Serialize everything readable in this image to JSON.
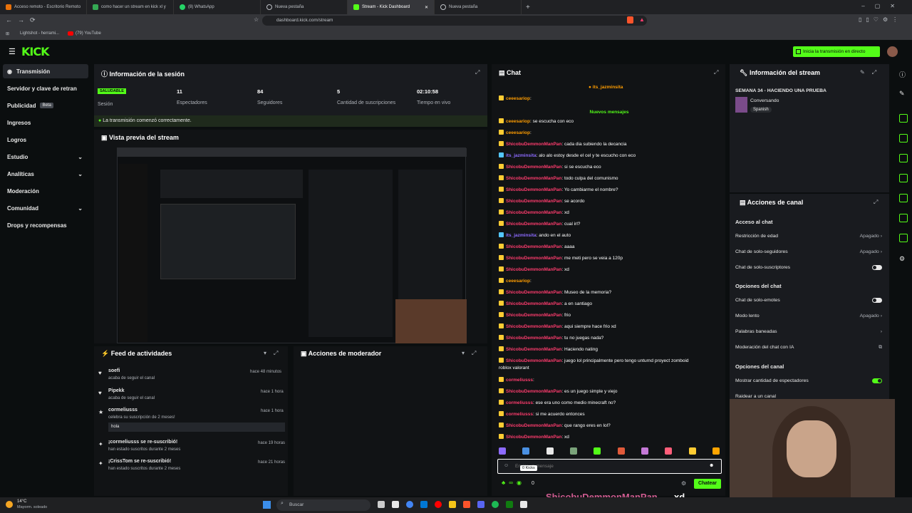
{
  "browser": {
    "tabs": [
      {
        "label": "Acceso remoto - Escritorio Remoto",
        "active": false
      },
      {
        "label": "como hacer un stream en kick xl y",
        "active": false
      },
      {
        "label": "(8) WhatsApp",
        "active": false
      },
      {
        "label": "Nueva pestaña",
        "active": false
      },
      {
        "label": "Stream - Kick Dashboard",
        "active": true
      },
      {
        "label": "Nueva pestaña",
        "active": false
      }
    ],
    "url": "dashboard.kick.com/stream",
    "bookmarks": [
      "Lightshot - herrami...",
      "(79) YouTube"
    ]
  },
  "header": {
    "logo": "KICK",
    "go_live": "Inicia la transmisión en directo"
  },
  "sidebar": {
    "items": [
      "Transmisión",
      "Servidor y clave de retran",
      "Publicidad",
      "Ingresos",
      "Logros",
      "Estudio",
      "Analíticas",
      "Moderación",
      "Comunidad",
      "Drops y recompensas"
    ],
    "beta": "Beta"
  },
  "session": {
    "title": "Información de la sesión",
    "status": "SALUDABLE",
    "status_label": "Sesión",
    "stats": [
      {
        "value": "11",
        "label": "Espectadores"
      },
      {
        "value": "84",
        "label": "Seguidores"
      },
      {
        "value": "5",
        "label": "Cantidad de suscripciones"
      },
      {
        "value": "02:10:58",
        "label": "Tiempo en vivo"
      }
    ],
    "message": "La transmisión comenzó correctamente."
  },
  "preview": {
    "title": "Vista previa del stream"
  },
  "feed": {
    "title": "Feed de actividades",
    "items": [
      {
        "user": "soefi",
        "desc": "acaba de seguir el canal",
        "time": "hace 48 minutos"
      },
      {
        "user": "Pipekk",
        "desc": "acaba de seguir el canal",
        "time": "hace 1 hora"
      },
      {
        "user": "cormeliusss",
        "desc": "celebra su suscripción de 2 meses!",
        "time": "hace 1 hora",
        "msg": "hola"
      },
      {
        "user": "¡cormeliusss se re-suscribió!",
        "desc": "han estado suscritos durante 2 meses",
        "time": "hace 19 horas"
      },
      {
        "user": "¡CrissTom se re-suscribió!",
        "desc": "han estado suscritos durante 2 meses",
        "time": "hace 21 horas"
      }
    ]
  },
  "mod": {
    "title": "Acciones de moderador"
  },
  "chat": {
    "title": "Chat",
    "pinned": "its_jazminsita",
    "new_messages": "Nuevos mensajes",
    "messages": [
      {
        "user": "ceeesariop",
        "text": "",
        "style": "u2"
      },
      {
        "user": "ceeesariop",
        "text": "se escucha con eco",
        "style": "u2"
      },
      {
        "user": "ceeesariop",
        "text": "",
        "style": "u2"
      },
      {
        "user": "ShicobuDemmonManPan",
        "text": "cada dia subiendo la decancia",
        "style": "u3"
      },
      {
        "user": "its_jazminsita",
        "text": "alo alo estoy desde el cel y te escucho con eco",
        "style": "u4"
      },
      {
        "user": "ShicobuDemmonManPan",
        "text": "si se escucha eco",
        "style": "u3"
      },
      {
        "user": "ShicobuDemmonManPan",
        "text": "todo culpa del comunismo",
        "style": "u3"
      },
      {
        "user": "ShicobuDemmonManPan",
        "text": "Yo cambiarme el nombre?",
        "style": "u3"
      },
      {
        "user": "ShicobuDemmonManPan",
        "text": "se acordo",
        "style": "u3"
      },
      {
        "user": "ShicobuDemmonManPan",
        "text": "xd",
        "style": "u3"
      },
      {
        "user": "ShicobuDemmonManPan",
        "text": "cual irl?",
        "style": "u3"
      },
      {
        "user": "its_jazminsita",
        "text": "ando en el auto",
        "style": "u4"
      },
      {
        "user": "ShicobuDemmonManPan",
        "text": "aaaa",
        "style": "u3"
      },
      {
        "user": "ShicobuDemmonManPan",
        "text": "me meti pero se veia a 120p",
        "style": "u3"
      },
      {
        "user": "ShicobuDemmonManPan",
        "text": "xd",
        "style": "u3"
      },
      {
        "user": "ceeesariop",
        "text": "",
        "style": "u2"
      },
      {
        "user": "ShicobuDemmonManPan",
        "text": "Museo de la memoria?",
        "style": "u3"
      },
      {
        "user": "ShicobuDemmonManPan",
        "text": "a en santiago",
        "style": "u3"
      },
      {
        "user": "ShicobuDemmonManPan",
        "text": "frio",
        "style": "u3"
      },
      {
        "user": "ShicobuDemmonManPan",
        "text": "aqui siempre hace frio xd",
        "style": "u3"
      },
      {
        "user": "ShicobuDemmonManPan",
        "text": "tu no juegas nada?",
        "style": "u3"
      },
      {
        "user": "ShicobuDemmonManPan",
        "text": "Haciendo nating",
        "style": "u3"
      },
      {
        "user": "ShicobuDemmonManPan",
        "text": "juego lol principalmente pero tengo unturnd proyect zomboid",
        "style": "u3"
      },
      {
        "user": "",
        "text": "roblox valorant",
        "style": ""
      },
      {
        "user": "cormeliusss",
        "text": "",
        "style": "u3"
      },
      {
        "user": "ShicobuDemmonManPan",
        "text": "es un juego simple y viejo",
        "style": "u3"
      },
      {
        "user": "cormeliusss",
        "text": "ese era uno como medio minecraft no?",
        "style": "u3"
      },
      {
        "user": "cormeliusss",
        "text": "si me acuerdo entonces",
        "style": "u3"
      },
      {
        "user": "ShicobuDemmonManPan",
        "text": "que rango eres en lol?",
        "style": "u3"
      },
      {
        "user": "ShicobuDemmonManPan",
        "text": "xd",
        "style": "u3"
      }
    ],
    "placeholder": "Enviar un mensaje",
    "kicks": "0 Kicks",
    "count": "0",
    "send": "Chatear"
  },
  "info": {
    "title": "Información del stream",
    "stream_title": "SEMANA 34 - HACIENDO UNA PRUEBA",
    "category": "Conversando",
    "language": "Spanish"
  },
  "actions": {
    "title": "Acciones de canal",
    "access_title": "Acceso al chat",
    "access": [
      {
        "label": "Restricción de edad",
        "value": "Apagado"
      },
      {
        "label": "Chat de solo-seguidores",
        "value": "Apagado"
      },
      {
        "label": "Chat de solo-suscriptores",
        "value": ""
      }
    ],
    "chat_title": "Opciones del chat",
    "chat": [
      {
        "label": "Chat de solo-emotes",
        "value": ""
      },
      {
        "label": "Modo lento",
        "value": "Apagado"
      },
      {
        "label": "Palabras baneadas",
        "value": ""
      },
      {
        "label": "Moderación del chat con IA",
        "value": ""
      }
    ],
    "channel_title": "Opciones del canal",
    "channel": [
      {
        "label": "Mostrar cantidad de espectadores",
        "value": ""
      },
      {
        "label": "Raidear a un canal",
        "value": ""
      }
    ]
  },
  "overlay": {
    "name": "ShicobuDemmonManPan",
    "text": "xd"
  },
  "taskbar": {
    "weather_temp": "14°C",
    "weather_desc": "Mayorm. soleado",
    "search": "Buscar"
  }
}
